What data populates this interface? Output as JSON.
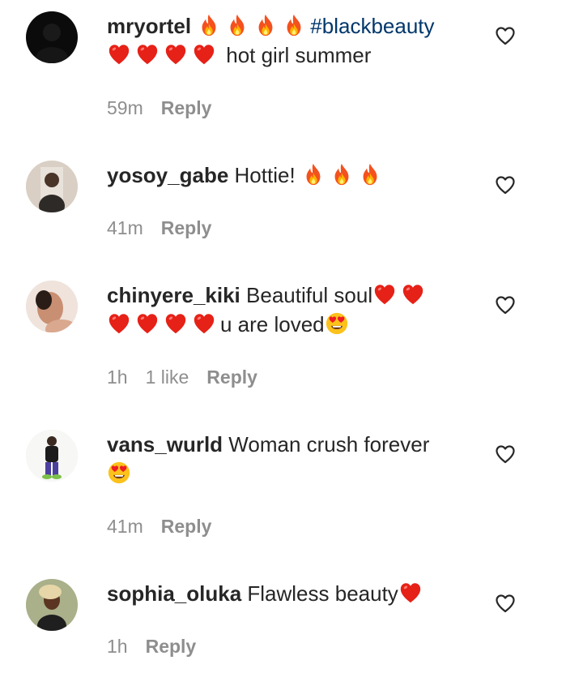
{
  "comments": [
    {
      "username": "mryortel",
      "hashtag": "#blackbeauty",
      "text": "hot girl summer",
      "time": "59m",
      "reply": "Reply"
    },
    {
      "username": "yosoy_gabe",
      "text": "Hottie!",
      "time": "41m",
      "reply": "Reply"
    },
    {
      "username": "chinyere_kiki",
      "text": "Beautiful soul",
      "text2": "u are loved",
      "time": "1h",
      "likes": "1 like",
      "reply": "Reply"
    },
    {
      "username": "vans_wurld",
      "text": "Woman crush forever",
      "time": "41m",
      "reply": "Reply"
    },
    {
      "username": "sophia_oluka",
      "text": "Flawless beauty",
      "time": "1h",
      "reply": "Reply"
    }
  ],
  "icons": {
    "fire": "fire-emoji",
    "heart": "red-heart-emoji",
    "heart_eyes": "heart-eyes-emoji",
    "like": "heart-outline-icon"
  },
  "colors": {
    "text": "#262626",
    "muted": "#8e8e8e",
    "hashtag": "#00376b",
    "heart": "#e0245e",
    "fire": "#f97316"
  }
}
